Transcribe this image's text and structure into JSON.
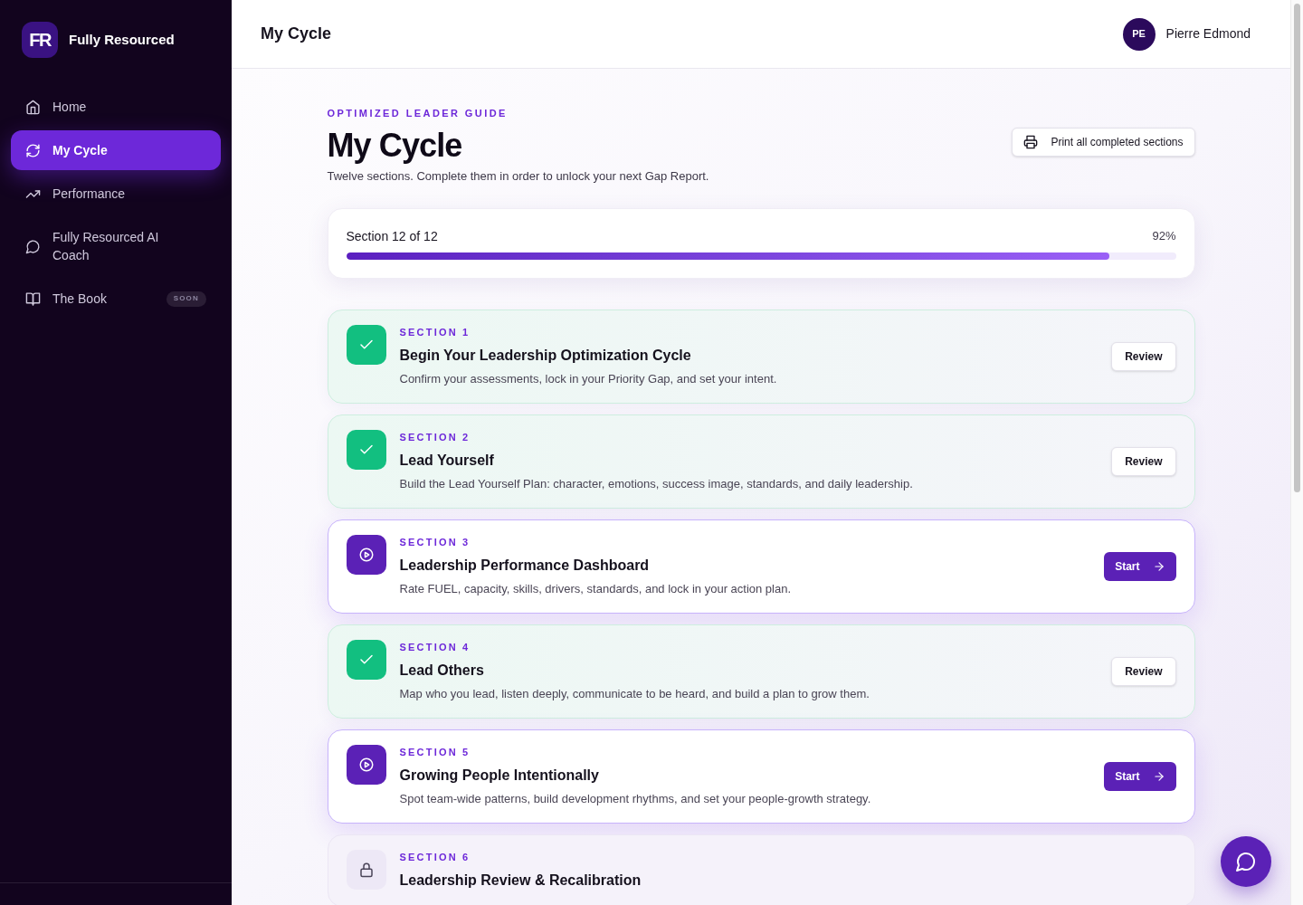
{
  "brand": {
    "logo": "FR",
    "name": "Fully Resourced"
  },
  "sidebar": {
    "items": [
      {
        "label": "Home",
        "selected": false
      },
      {
        "label": "My Cycle",
        "selected": true
      },
      {
        "label": "Performance",
        "selected": false
      },
      {
        "label": "Fully Resourced AI Coach",
        "selected": false
      },
      {
        "label": "The Book",
        "selected": false,
        "badge": "SOON"
      }
    ]
  },
  "header": {
    "title": "My Cycle",
    "user": {
      "initials": "PE",
      "name": "Pierre Edmond"
    }
  },
  "page": {
    "eyebrow": "OPTIMIZED LEADER GUIDE",
    "title": "My Cycle",
    "subtitle": "Twelve sections. Complete them in order to unlock your next Gap Report.",
    "print_button": "Print all completed sections"
  },
  "progress": {
    "label": "Section 12 of 12",
    "reading": "92%",
    "level": 0.92
  },
  "sections": [
    {
      "kind": "completed",
      "label": "SECTION 1",
      "title": "Begin Your Leadership Optimization Cycle",
      "description": "Confirm your assessments, lock in your Priority Gap, and set your intent.",
      "action": "Review"
    },
    {
      "kind": "completed",
      "label": "SECTION 2",
      "title": "Lead Yourself",
      "description": "Build the Lead Yourself Plan: character, emotions, success image, standards, and daily leadership.",
      "action": "Review"
    },
    {
      "kind": "available",
      "label": "SECTION 3",
      "title": "Leadership Performance Dashboard",
      "description": "Rate FUEL, capacity, skills, drivers, standards, and lock in your action plan.",
      "action": "Start"
    },
    {
      "kind": "completed",
      "label": "SECTION 4",
      "title": "Lead Others",
      "description": "Map who you lead, listen deeply, communicate to be heard, and build a plan to grow them.",
      "action": "Review"
    },
    {
      "kind": "available",
      "label": "SECTION 5",
      "title": "Growing People Intentionally",
      "description": "Spot team-wide patterns, build development rhythms, and set your people-growth strategy.",
      "action": "Start"
    },
    {
      "kind": "locked",
      "label": "SECTION 6",
      "title": "Leadership Review & Recalibration"
    }
  ]
}
